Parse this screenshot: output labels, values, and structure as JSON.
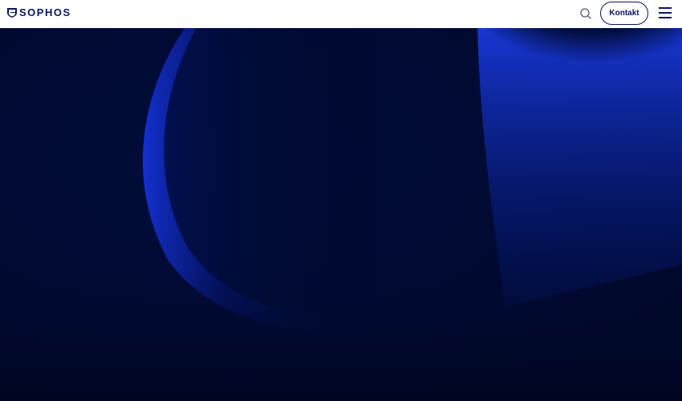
{
  "header": {
    "logo_text": "SOPHOS",
    "contact_label": "Kontakt",
    "search_icon": "search-icon",
    "menu_icon": "hamburger-menu-icon"
  },
  "colors": {
    "brand_navy": "#0a1464",
    "hero_bg": "#000a32",
    "hero_glow": "#1a3cff"
  }
}
